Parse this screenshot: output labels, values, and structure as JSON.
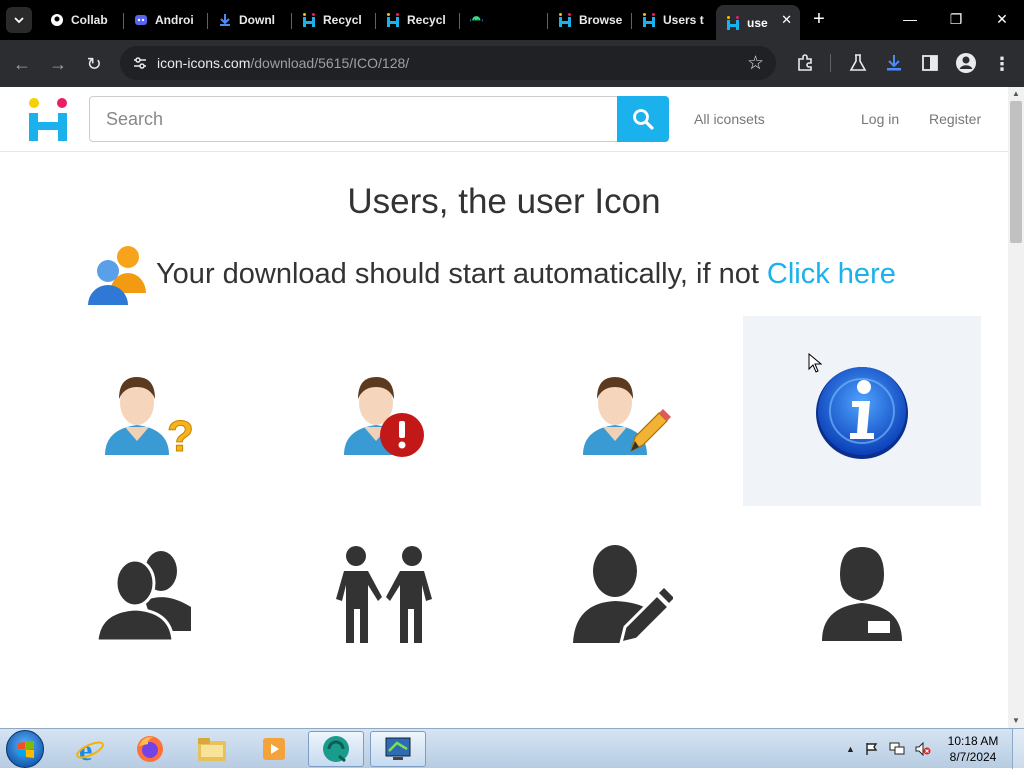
{
  "browser": {
    "tabs": [
      {
        "label": "Collab",
        "icon": "github-icon"
      },
      {
        "label": "Androi",
        "icon": "discord-icon"
      },
      {
        "label": "Downl",
        "icon": "download-icon"
      },
      {
        "label": "Recycl",
        "icon": "icon-icons-favicon"
      },
      {
        "label": "Recycl",
        "icon": "icon-icons-favicon"
      },
      {
        "label": "",
        "icon": "android-icon"
      },
      {
        "label": "Browse",
        "icon": "icon-icons-favicon"
      },
      {
        "label": "Users t",
        "icon": "icon-icons-favicon"
      },
      {
        "label": "use",
        "icon": "icon-icons-favicon",
        "active": true
      }
    ],
    "url_host": "icon-icons.com",
    "url_path": "/download/5615/ICO/128/"
  },
  "site": {
    "search_placeholder": "Search",
    "nav": {
      "all_iconsets": "All iconsets",
      "login": "Log in",
      "register": "Register"
    },
    "page_title": "Users, the user Icon",
    "download_text": "Your download should start automatically, if not ",
    "click_here": "Click here",
    "icons_row1": [
      "user-help-icon",
      "user-error-icon",
      "user-edit-icon",
      "info-icon"
    ],
    "icons_row2": [
      "users-group-icon",
      "handshake-people-icon",
      "user-edit-silhouette-icon",
      "user-badge-icon"
    ]
  },
  "taskbar": {
    "apps": [
      "internet-explorer-icon",
      "firefox-icon",
      "file-explorer-icon",
      "media-player-icon",
      "chrome-app-icon",
      "network-app-icon"
    ],
    "time": "10:18 AM",
    "date": "8/7/2024"
  },
  "colors": {
    "accent": "#1ab1ec",
    "icon_dark": "#333333"
  }
}
